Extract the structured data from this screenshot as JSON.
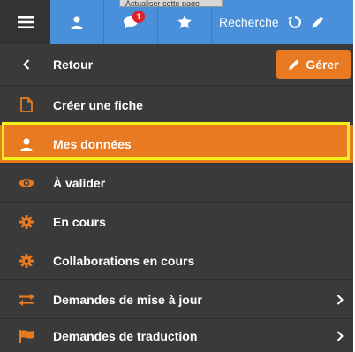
{
  "toolbar": {
    "tooltip": "Actualiser cette page",
    "notification_count": "1",
    "search_label": "Recherche"
  },
  "back": {
    "label": "Retour",
    "manage_label": "Gérer"
  },
  "menu": {
    "items": [
      {
        "label": "Créer une fiche",
        "icon": "file-icon"
      },
      {
        "label": "Mes données",
        "icon": "user-icon",
        "active": true
      },
      {
        "label": "À valider",
        "icon": "eye-icon"
      },
      {
        "label": "En cours",
        "icon": "gear-icon"
      },
      {
        "label": "Collaborations en cours",
        "icon": "gear-icon"
      },
      {
        "label": "Demandes de mise à jour",
        "icon": "exchange-arrows-icon",
        "has_submenu": true
      },
      {
        "label": "Demandes de traduction",
        "icon": "flag-icon",
        "has_submenu": true
      }
    ]
  },
  "colors": {
    "accent": "#e87a22",
    "toolbar_blue": "#4a8fd9",
    "panel_bg": "#3a3a3a",
    "highlight": "#f5f018"
  }
}
